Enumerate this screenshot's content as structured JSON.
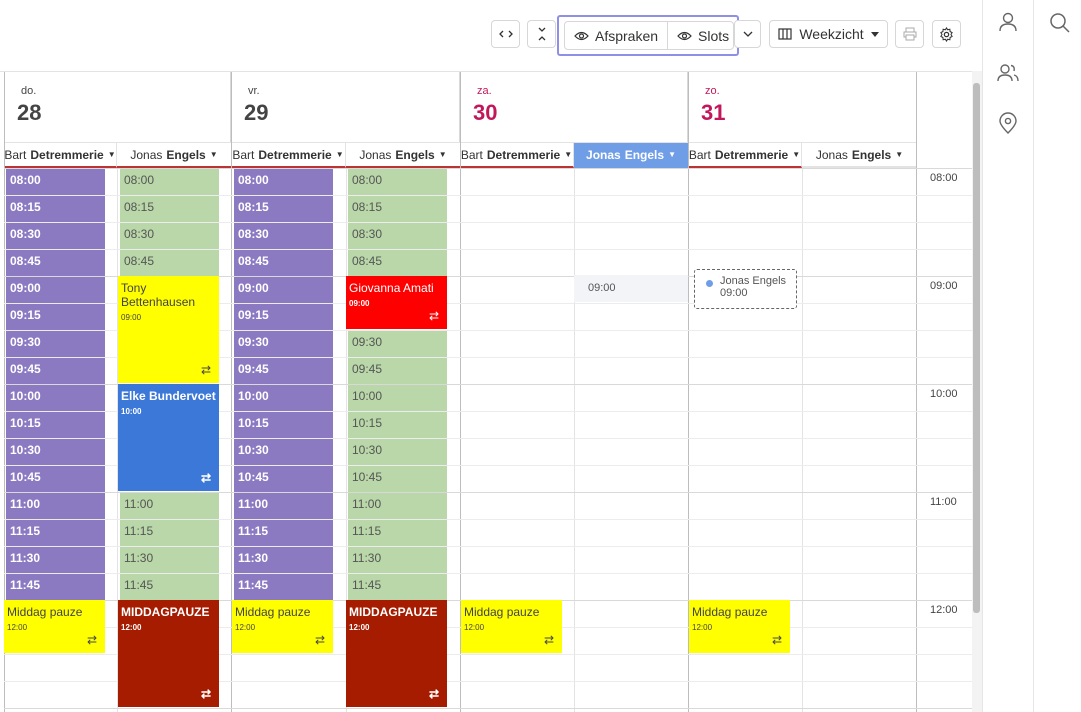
{
  "toolbar": {
    "view_afspraken": "Afspraken",
    "view_slots": "Slots",
    "weekview": "Weekzicht"
  },
  "days": [
    {
      "weekday": "do.",
      "date": "28"
    },
    {
      "weekday": "vr.",
      "date": "29"
    },
    {
      "weekday": "za.",
      "date": "30"
    },
    {
      "weekday": "zo.",
      "date": "31"
    }
  ],
  "resources": [
    {
      "first": "Bart",
      "last": "Detremmerie"
    },
    {
      "first": "Jonas",
      "last": "Engels"
    }
  ],
  "hours": [
    "08:00",
    "09:00",
    "10:00",
    "11:00",
    "12:00"
  ],
  "slots_purple_day28": [
    "08:00",
    "08:15",
    "08:30",
    "08:45",
    "09:00",
    "09:15",
    "09:30",
    "09:45",
    "10:00",
    "10:15",
    "10:30",
    "10:45",
    "11:00",
    "11:15",
    "11:30",
    "11:45"
  ],
  "slots_green_day28": [
    "08:00",
    "08:15",
    "08:30",
    "08:45",
    "11:00",
    "11:15",
    "11:30",
    "11:45"
  ],
  "slots_green_day29": [
    "08:00",
    "08:15",
    "08:30",
    "08:45",
    "09:30",
    "09:45",
    "10:00",
    "10:15",
    "10:30",
    "10:45",
    "11:00",
    "11:15",
    "11:30",
    "11:45"
  ],
  "appointments": {
    "tony": {
      "name": "Tony Bettenhausen",
      "time": "09:00"
    },
    "elke": {
      "name": "Elke Bundervoet",
      "time": "10:00"
    },
    "giovanna": {
      "name": "Giovanna Amati",
      "time": "09:00"
    },
    "pause": {
      "name": "Middag pauze",
      "time": "12:00"
    },
    "middagpauze": {
      "name": "MIDDAGPAUZE",
      "time": "12:00"
    }
  },
  "hover": {
    "time": "09:00"
  },
  "drag": {
    "name": "Jonas Engels",
    "time": "09:00"
  },
  "colors": {
    "purple": "#8b7ac2",
    "green": "#b9d7a8",
    "yellow": "#ffff00",
    "red": "#ff0000",
    "blue": "#3b78d8",
    "darkred": "#a61c00",
    "weekend": "#c2185b",
    "active": "#6f9de6"
  }
}
